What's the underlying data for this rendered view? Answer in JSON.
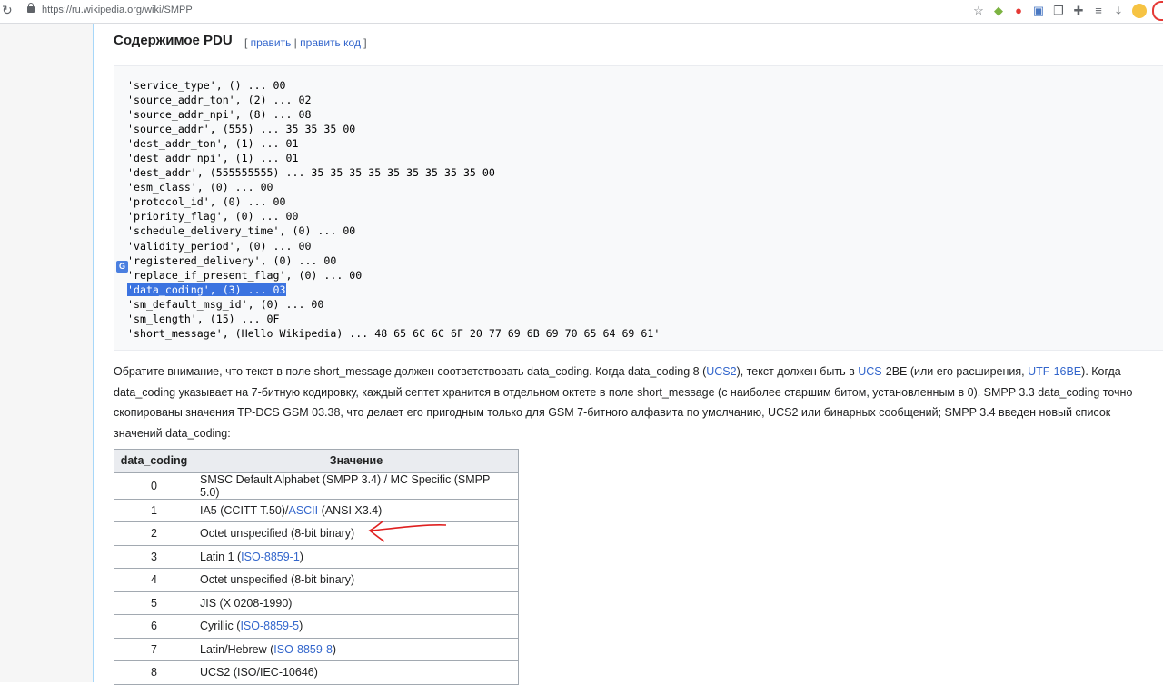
{
  "browser": {
    "url": "https://ru.wikipedia.org/wiki/SMPP"
  },
  "section": {
    "title": "Содержимое PDU",
    "edit_open": "[ ",
    "edit_link": "править",
    "edit_sep": " | ",
    "edit_code_link": "править код",
    "edit_close": " ]"
  },
  "code_lines": [
    "'service_type', () ... 00",
    "'source_addr_ton', (2) ... 02",
    "'source_addr_npi', (8) ... 08",
    "'source_addr', (555) ... 35 35 35 00",
    "'dest_addr_ton', (1) ... 01",
    "'dest_addr_npi', (1) ... 01",
    "'dest_addr', (555555555) ... 35 35 35 35 35 35 35 35 35 00",
    "'esm_class', (0) ... 00",
    "'protocol_id', (0) ... 00",
    "'priority_flag', (0) ... 00",
    "'schedule_delivery_time', (0) ... 00",
    "'validity_period', (0) ... 00",
    "'registered_delivery', (0) ... 00",
    "'replace_if_present_flag', (0) ... 00",
    "'data_coding', (3) ... 03",
    "'sm_default_msg_id', (0) ... 00",
    "'sm_length', (15) ... 0F",
    "'short_message', (Hello Wikipedia) ... 48 65 6C 6C 6F 20 77 69 6B 69 70 65 64 69 61'"
  ],
  "highlight_index": 14,
  "translate_icon": "G",
  "paragraph": {
    "p1": "Обратите внимание, что текст в поле short_message должен соответствовать data_coding. Когда data_coding 8 (",
    "l1": "UCS2",
    "p2": "), текст должен быть в ",
    "l2": "UCS",
    "p3": "-2BE (или его расширения, ",
    "l3": "UTF-16BE",
    "p4": "). Когда data_coding указывает на 7-битную кодировку, каждый септет хранится в отдельном октете в поле short_message (с наиболее старшим битом, установленным в 0). SMPP 3.3 data_coding точно скопированы значения TP-DCS GSM 03.38, что делает его пригодным только для GSM 7-битного алфавита по умолчанию, UCS2 или бинарных сообщений; SMPP 3.4 введен новый список значений data_coding:"
  },
  "table": {
    "headers": [
      "data_coding",
      "Значение"
    ],
    "rows": [
      {
        "code": "0",
        "pre": "SMSC Default Alphabet (SMPP 3.4) / MC Specific (SMPP 5.0)",
        "link": "",
        "link2": "",
        "post": ""
      },
      {
        "code": "1",
        "pre": "IA5 (CCITT T.50)/",
        "link": "ASCII",
        "link2": "",
        "post": " (ANSI X3.4)"
      },
      {
        "code": "2",
        "pre": "Octet unspecified (8-bit binary)",
        "link": "",
        "link2": "",
        "post": ""
      },
      {
        "code": "3",
        "pre": "Latin 1 (",
        "link": "ISO-8859-1",
        "link2": "",
        "post": ")"
      },
      {
        "code": "4",
        "pre": "Octet unspecified (8-bit binary)",
        "link": "",
        "link2": "",
        "post": ""
      },
      {
        "code": "5",
        "pre": "JIS (X 0208-1990)",
        "link": "",
        "link2": "",
        "post": ""
      },
      {
        "code": "6",
        "pre": "Cyrillic (",
        "link": "ISO-8859-5",
        "link2": "",
        "post": ")"
      },
      {
        "code": "7",
        "pre": "Latin/Hebrew (",
        "link": "ISO-8859-8",
        "link2": "",
        "post": ")"
      },
      {
        "code": "8",
        "pre": "UCS2 (ISO/IEC-10646)",
        "link": "",
        "link2": "",
        "post": ""
      }
    ]
  },
  "icons": [
    "reload-icon",
    "lock-icon",
    "star-icon",
    "extension-icon",
    "opera-icon",
    "translate-icon",
    "copy-icon",
    "puzzle-icon",
    "reading-list-icon",
    "download-icon"
  ],
  "colors": {
    "link": "#3366cc",
    "highlight": "#3b73e0",
    "annotation_arrow": "#e02020"
  }
}
